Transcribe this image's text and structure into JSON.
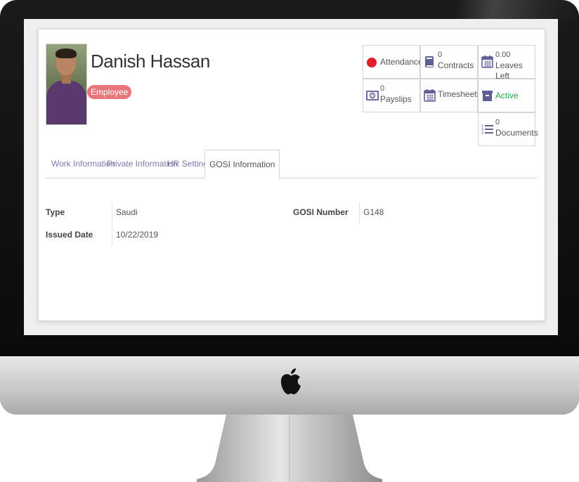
{
  "employee": {
    "name": "Danish Hassan",
    "badge": "Employee"
  },
  "stat_buttons": {
    "attendance": {
      "label": "Attendance",
      "icon": "circle-icon",
      "color": "#e31c2b"
    },
    "contracts": {
      "count": "0",
      "label": "Contracts",
      "icon": "book-icon"
    },
    "leaves": {
      "count": "0.00",
      "label": "Leaves Left",
      "icon": "calendar-icon"
    },
    "payslips": {
      "count": "0",
      "label": "Payslips",
      "icon": "money-icon"
    },
    "timesheets": {
      "label": "Timesheets",
      "icon": "calendar-icon"
    },
    "active": {
      "label": "Active",
      "icon": "archive-icon",
      "color": "#28a745"
    },
    "documents": {
      "count": "0",
      "label": "Documents",
      "icon": "list-icon"
    }
  },
  "tabs": [
    {
      "label": "Work Information"
    },
    {
      "label": "Private Information"
    },
    {
      "label": "HR Settings"
    },
    {
      "label": "GOSI Information"
    }
  ],
  "active_tab": "GOSI Information",
  "gosi": {
    "type_label": "Type",
    "type_value": "Saudi",
    "issued_label": "Issued Date",
    "issued_value": "10/22/2019",
    "number_label": "GOSI Number",
    "number_value": "G148"
  },
  "colors": {
    "accent": "#7c7bad",
    "badge": "#e8777b"
  }
}
